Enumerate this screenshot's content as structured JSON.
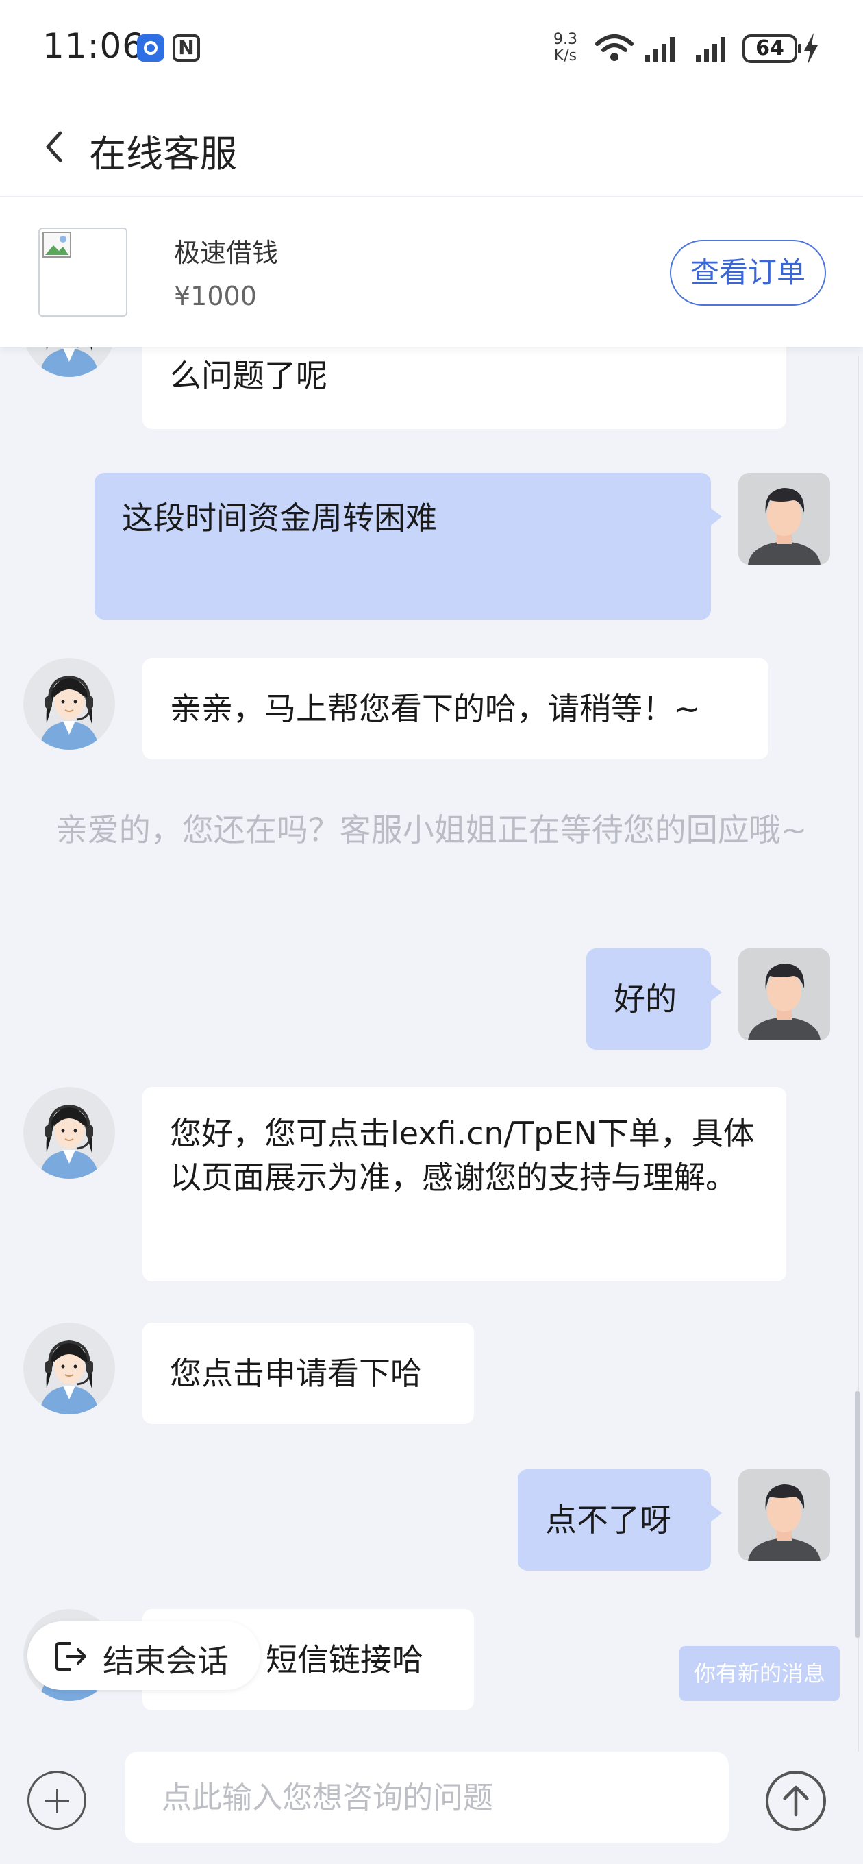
{
  "status_bar": {
    "time": "11:06",
    "net_speed_value": "9.3",
    "net_speed_unit": "K/s",
    "battery": "64"
  },
  "header": {
    "title": "在线客服"
  },
  "order": {
    "name": "极速借钱",
    "price": "¥1000",
    "view_order_label": "查看订单"
  },
  "messages": [
    {
      "role": "agent",
      "text": "么问题了呢"
    },
    {
      "role": "user",
      "text": "这段时间资金周转困难"
    },
    {
      "role": "agent",
      "text": "亲亲，马上帮您看下的哈，请稍等！~"
    },
    {
      "role": "user",
      "text": "好的"
    },
    {
      "role": "agent",
      "text": "您好，您可点击lexfi.cn/TpEN下单，具体以页面展示为准，感谢您的支持与理解。"
    },
    {
      "role": "agent",
      "text": "您点击申请看下哈"
    },
    {
      "role": "user",
      "text": "点不了呀"
    },
    {
      "role": "agent",
      "text": "短信链接哈"
    }
  ],
  "system_note": "亲爱的，您还在吗？客服小姐姐正在等待您的回应哦~",
  "end_session_label": "结束会话",
  "new_message_toast": "你有新的消息",
  "input": {
    "placeholder": "点此输入您想咨询的问题"
  },
  "colors": {
    "accent": "#3a66d6",
    "user_bubble": "#c7d5fb",
    "agent_bubble": "#ffffff",
    "background": "#f1f3f9"
  }
}
